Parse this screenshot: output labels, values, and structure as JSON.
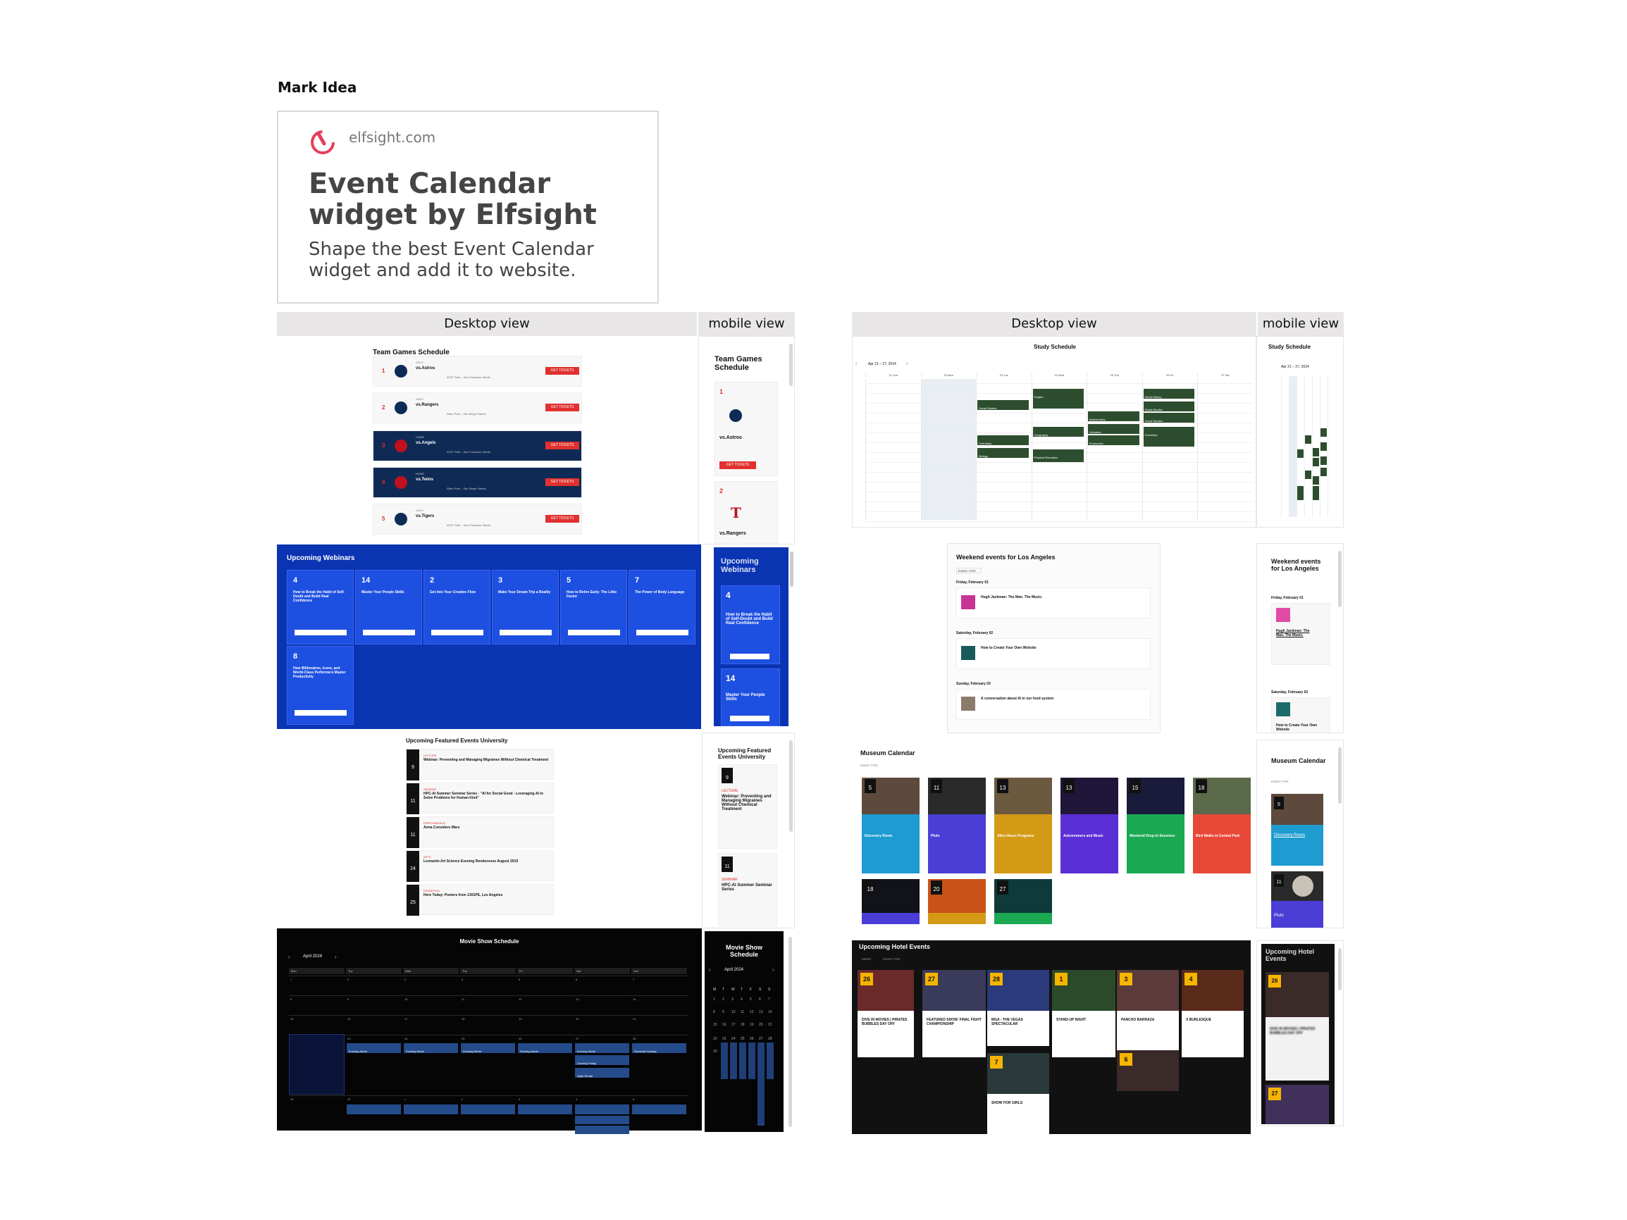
{
  "page": {
    "mark_label": "Mark Idea",
    "card": {
      "domain": "elfsight.com",
      "title": "Event Calendar widget by Elfsight",
      "description": "Shape the best Event Calendar widget and add it to website."
    },
    "headers": {
      "left_desktop": "Desktop view",
      "left_mobile": "mobile view",
      "right_desktop": "Desktop view",
      "right_mobile": "mobile view"
    },
    "colors": {
      "accent_red": "#e0312f",
      "brand_blue": "#0b34b3",
      "navy": "#0f2a55",
      "green": "#2d4e2e"
    }
  },
  "team_games": {
    "title": "Team Games Schedule",
    "mobile_title": "Team Games Schedule",
    "button": "GET TICKETS",
    "rows": [
      {
        "day": "1",
        "type": "AWAY",
        "name": "vs.Astros",
        "info": "AT&T Park – San Francisco Giants",
        "dark": false
      },
      {
        "day": "2",
        "type": "AWAY",
        "name": "vs.Rangers",
        "info": "Rabo Park – San Diego Padres",
        "dark": false
      },
      {
        "day": "3",
        "type": "HOME",
        "name": "vs.Angels",
        "info": "AT&T Park – San Francisco Giants",
        "dark": true
      },
      {
        "day": "4",
        "type": "HOME",
        "name": "vs.Twins",
        "info": "Rabo Park – San Diego Padres",
        "dark": true
      },
      {
        "day": "5",
        "type": "AWAY",
        "name": "vs.Tigers",
        "info": "AT&T Park – San Francisco Giants",
        "dark": false
      }
    ],
    "mobile_rows": [
      {
        "day": "1",
        "name": "vs.Astros"
      },
      {
        "day": "2",
        "name": "vs.Rangers"
      }
    ]
  },
  "webinars": {
    "title": "Upcoming Webinars",
    "mobile_title": "Upcoming Webinars",
    "button": "REGISTER NOW",
    "cards": [
      {
        "day": "4",
        "title": "How to Break the Habit of Self-Doubt and Build Real Confidence"
      },
      {
        "day": "14",
        "title": "Master Your People Skills"
      },
      {
        "day": "2",
        "title": "Get Into Your Creative Flow"
      },
      {
        "day": "3",
        "title": "Make Your Dream Trip a Reality"
      },
      {
        "day": "5",
        "title": "How to Retire Early: The Little Factor"
      },
      {
        "day": "7",
        "title": "The Power of Body Language"
      },
      {
        "day": "8",
        "title": "How Billionaires, Icons, and World-Class Performers Master Productivity"
      }
    ],
    "mobile_cards": [
      {
        "day": "4",
        "title": "How to Break the Habit of Self-Doubt and Build Real Confidence"
      },
      {
        "day": "14",
        "title": "Master Your People Skills"
      }
    ]
  },
  "university": {
    "title": "Upcoming Featured Events University",
    "mobile_title": "Upcoming Featured Events University",
    "rows": [
      {
        "day": "9",
        "cat": "LECTURE",
        "title": "Webinar: Preventing and Managing Migraines Without Chemical Treatment"
      },
      {
        "day": "11",
        "cat": "SEMINAR",
        "title": "HPC-AI Summer Seminar Series - \"AI for Social Good - Leveraging AI to Solve Problems for Human Kind\""
      },
      {
        "day": "11",
        "cat": "PERFORMANCE",
        "title": "Anna Considers Mars"
      },
      {
        "day": "24",
        "cat": "ARTS",
        "title": "Leonardo Art Science Evening Rendezvous August 2019"
      },
      {
        "day": "25",
        "cat": "EXHIBITION",
        "title": "Here Today: Posters from 1301PE, Los Angeles"
      }
    ],
    "mobile_rows": [
      {
        "day": "9",
        "cat": "LECTURE",
        "title": "Webinar: Preventing and Managing Migraines Without Chemical Treatment"
      },
      {
        "day": "11",
        "cat": "SEMINAR",
        "title": "HPC-AI Summer Seminar Series"
      }
    ]
  },
  "movie": {
    "title": "Movie Show Schedule",
    "mobile_title": "Movie Show Schedule",
    "month": "April 2024",
    "weekdays": [
      "Mon",
      "Tue",
      "Wed",
      "Thu",
      "Fri",
      "Sat",
      "Sun"
    ],
    "weeks": [
      [
        "1",
        "2",
        "3",
        "4",
        "5",
        "6",
        "7"
      ],
      [
        "8",
        "9",
        "10",
        "11",
        "12",
        "13",
        "14"
      ],
      [
        "15",
        "16",
        "17",
        "18",
        "19",
        "20",
        "21"
      ],
      [
        "22",
        "23",
        "24",
        "25",
        "26",
        "27",
        "28"
      ],
      [
        "29",
        "30",
        "1",
        "2",
        "3",
        "4",
        "5"
      ]
    ],
    "events": [
      "Evening Movie",
      "Evening Movie",
      "Evening Movie",
      "Evening Movie",
      "Evening Movie",
      "Evening Movie",
      "Romantic Sunday"
    ],
    "extra_events": [
      "Comedy Friday",
      "Night Rental"
    ],
    "mobile_weekdays": [
      "M",
      "T",
      "W",
      "T",
      "F",
      "S",
      "S"
    ]
  },
  "study": {
    "title": "Study Schedule",
    "mobile_title": "Study Schedule",
    "range": "Apr 21 – 27, 2024",
    "days": [
      "21 Sun",
      "22 Mon",
      "23 Tue",
      "24 Wed",
      "25 Thu",
      "26 Fri",
      "27 Sat"
    ],
    "classes": [
      "Social Studies",
      "Chemistry",
      "Biology",
      "English",
      "Geography",
      "Physical Education",
      "Mathematics",
      "Literature",
      "Economics",
      "World History",
      "Social Studies"
    ]
  },
  "weekend": {
    "title": "Weekend events for Los Angeles",
    "mobile_title": "Weekend events for Los Angeles",
    "filter": "EVENT TYPE",
    "groups": [
      {
        "date": "Friday, February 01",
        "title": "Hugh Jackman: The Man. The Music."
      },
      {
        "date": "Saturday, February 02",
        "title": "How to Create Your Own Website"
      },
      {
        "date": "Sunday, February 03",
        "title": "A conversation about AI in our food system"
      }
    ]
  },
  "museum": {
    "title": "Museum Calendar",
    "mobile_title": "Museum Calendar",
    "filter": "EVENT TYPE",
    "tiles": [
      {
        "day": "5",
        "title": "Discovery Room",
        "color": "#1e9bd0"
      },
      {
        "day": "11",
        "title": "Pluto",
        "color": "#4a3ed6"
      },
      {
        "day": "13",
        "title": "After-Hours Programs",
        "color": "#d49a16"
      },
      {
        "day": "13",
        "title": "Astronomers and Music",
        "color": "#5a2fd6"
      },
      {
        "day": "15",
        "title": "Weekend Drop-in Sessions",
        "color": "#1aa852"
      },
      {
        "day": "18",
        "title": "Bird Walks in Central Park",
        "color": "#e84838"
      },
      {
        "day": "18",
        "title": "",
        "color": "#4a3ed6"
      },
      {
        "day": "20",
        "title": "",
        "color": "#d49a16"
      },
      {
        "day": "27",
        "title": "",
        "color": "#1aa852"
      }
    ]
  },
  "hotel": {
    "title": "Upcoming Hotel Events",
    "mobile_title": "Upcoming Hotel Events",
    "filters": [
      "DATES",
      "EVENT TYPE"
    ],
    "events": [
      {
        "day": "26",
        "title": "DIVE IN MOVIES | PIRATES BUBBLES DAY OFF"
      },
      {
        "day": "27",
        "title": "FEATURED SHOW: FINAL FIGHT CHAMPIONSHIP"
      },
      {
        "day": "28",
        "title": "MGA - THE VEGAS SPECTACULAR"
      },
      {
        "day": "1",
        "title": "STAND-UP NIGHT"
      },
      {
        "day": "3",
        "title": "PANCHO BARRAZA"
      },
      {
        "day": "4",
        "title": "X BURLESQUE"
      },
      {
        "day": "7",
        "title": "SHOW FOR GIRLS"
      },
      {
        "day": "6",
        "title": ""
      }
    ]
  }
}
